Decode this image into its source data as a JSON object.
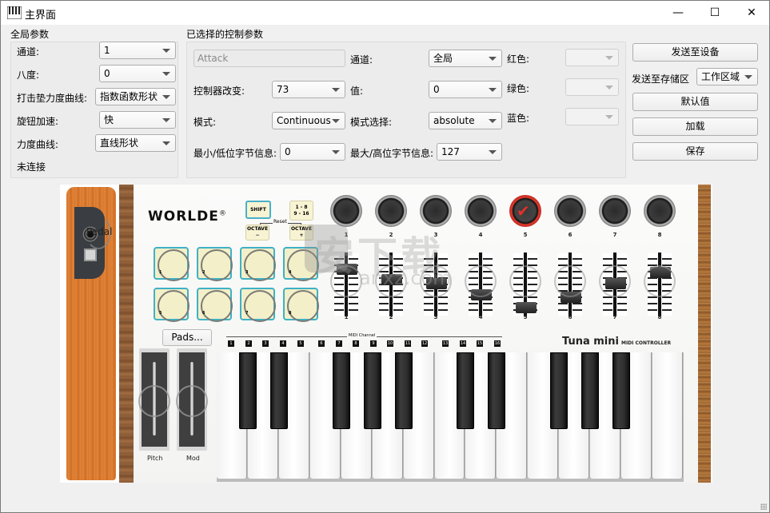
{
  "window": {
    "title": "主界面",
    "icon": "piano-keys-icon",
    "controls": {
      "minimize": "—",
      "maximize": "☐",
      "close": "✕"
    }
  },
  "global_params": {
    "title": "全局参数",
    "fields": [
      {
        "label": "通道:",
        "value": "1"
      },
      {
        "label": "八度:",
        "value": "0"
      },
      {
        "label": "打击垫力度曲线:",
        "value": "指数函数形状"
      },
      {
        "label": "旋钮加速:",
        "value": "快"
      },
      {
        "label": "力度曲线:",
        "value": "直线形状"
      }
    ],
    "status": "未连接"
  },
  "selected_params": {
    "title": "已选择的控制参数",
    "name_field": {
      "value": "Attack"
    },
    "controller_change": {
      "label": "控制器改变:",
      "value": "73"
    },
    "mode": {
      "label": "模式:",
      "value": "Continuous"
    },
    "min_lsb": {
      "label": "最小/低位字节信息:",
      "value": "0"
    },
    "channel": {
      "label": "通道:",
      "value": "全局"
    },
    "value": {
      "label": "值:",
      "value": "0"
    },
    "mode_select": {
      "label": "模式选择:",
      "value": "absolute"
    },
    "max_msb": {
      "label": "最大/高位字节信息:",
      "value": "127"
    },
    "red": {
      "label": "红色:",
      "value": ""
    },
    "green": {
      "label": "绿色:",
      "value": ""
    },
    "blue": {
      "label": "蓝色:",
      "value": ""
    }
  },
  "actions": {
    "send_to_device": "发送至设备",
    "send_to_bank_label": "发送至存储区",
    "send_to_bank_value": "工作区域",
    "default": "默认值",
    "load": "加载",
    "save": "保存"
  },
  "device": {
    "brand": "WORLDE",
    "registered": "®",
    "model": "Tuna mini",
    "model_sub": "MIDI CONTROLLER",
    "pedal_label": "Pedal",
    "shift": "SHIFT",
    "bank_btn_line1": "1 - 8",
    "bank_btn_line2": "9 - 16",
    "octave_minus": "OCTAVE −",
    "octave_plus": "OCTAVE +",
    "reset": "Reset",
    "pads": [
      "1",
      "2",
      "3",
      "4",
      "5",
      "6",
      "7",
      "8"
    ],
    "knobs": [
      "1",
      "2",
      "3",
      "4",
      "5",
      "6",
      "7",
      "8"
    ],
    "selected_knob": "5",
    "faders": [
      "1",
      "2",
      "3",
      "4",
      "5",
      "6",
      "7",
      "8"
    ],
    "fader_levels": [
      0.8,
      0.62,
      0.55,
      0.35,
      0.12,
      0.3,
      0.55,
      0.75
    ],
    "pads_button": "Pads...",
    "pitch_label": "Pitch",
    "mod_label": "Mod",
    "midi_channel_label": "MIDI Channel",
    "midi_channels": [
      "1",
      "2",
      "3",
      "4",
      "5",
      "6",
      "7",
      "8",
      "9",
      "10",
      "11",
      "12",
      "13",
      "14",
      "15",
      "16"
    ],
    "white_keys": 15
  },
  "watermark": {
    "text": "安下载",
    "sub": "anxz.com"
  }
}
